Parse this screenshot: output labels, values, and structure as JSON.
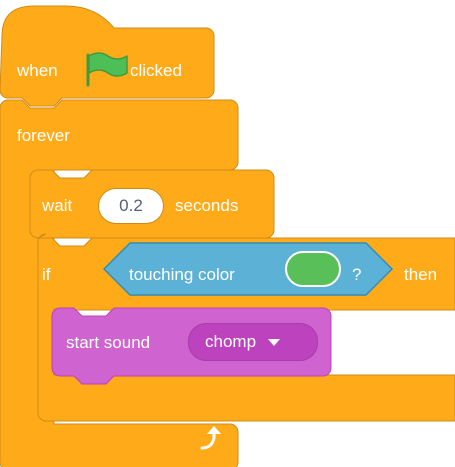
{
  "colors": {
    "control": "#ffab19",
    "control_stroke": "#cf8b17",
    "sensing": "#5cb1d6",
    "sensing_stroke": "#2e8eb8",
    "sound": "#cf63cf",
    "sound_stroke": "#bd42bd",
    "flag": "#4cbf56",
    "swatch": "#59c059"
  },
  "script": {
    "hat": {
      "when_label": "when",
      "flag_icon": "green-flag-icon",
      "clicked_label": "clicked"
    },
    "forever": {
      "label": "forever",
      "loop_icon": "loop-arrow-icon"
    },
    "wait": {
      "label": "wait",
      "value": "0.2",
      "unit": "seconds"
    },
    "if_block": {
      "if_label": "if",
      "condition": {
        "label": "touching color",
        "question": "?"
      },
      "then_label": "then"
    },
    "sound": {
      "label": "start sound",
      "selected": "chomp"
    }
  }
}
